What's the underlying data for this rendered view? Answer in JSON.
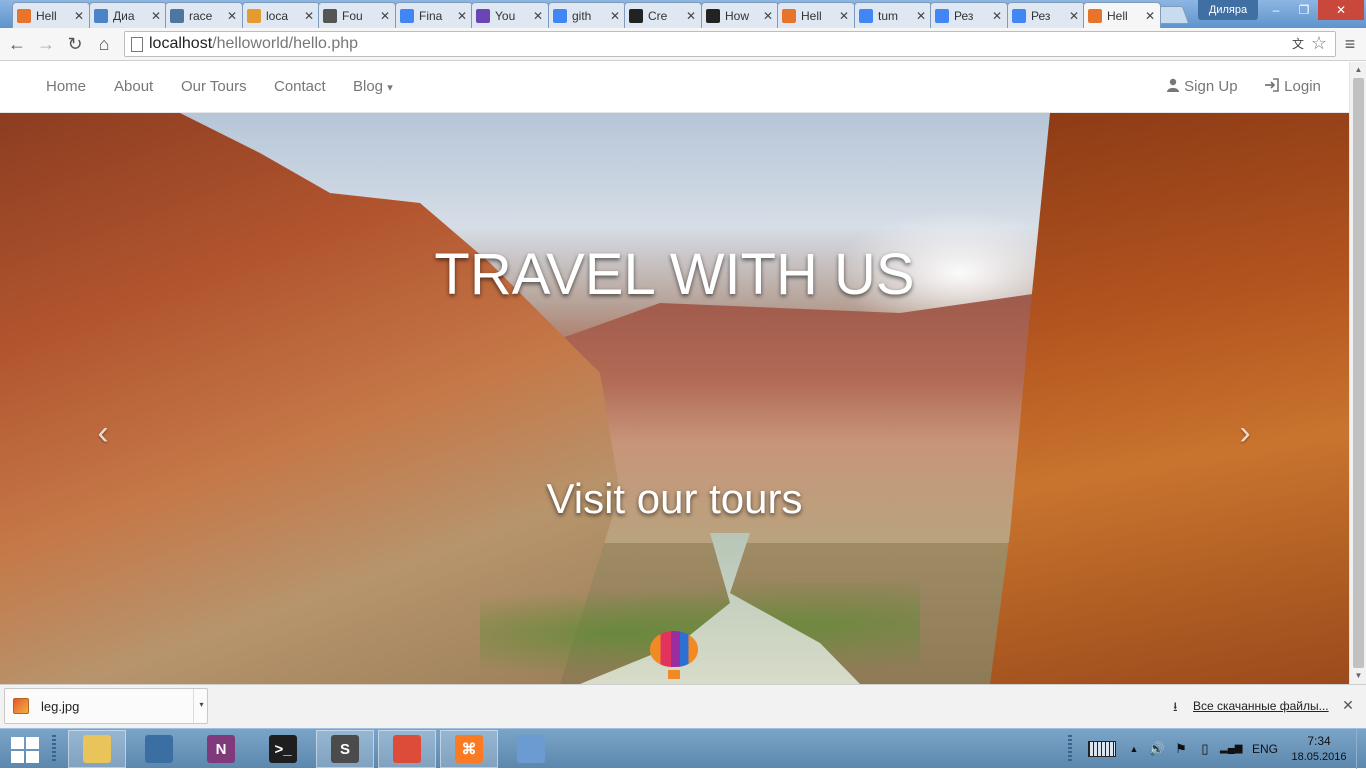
{
  "browser": {
    "tabs": [
      {
        "label": "Hell",
        "icon": "xampp-icon",
        "color": "#e8742b",
        "active": false
      },
      {
        "label": "Диа",
        "icon": "chat-icon",
        "color": "#4a83c6",
        "active": false
      },
      {
        "label": "race",
        "icon": "vk-icon",
        "color": "#4d76a1",
        "active": false
      },
      {
        "label": "loca",
        "icon": "phpmyadmin-icon",
        "color": "#e49b2f",
        "active": false
      },
      {
        "label": "Fou",
        "icon": "profile-icon",
        "color": "#555555",
        "active": false
      },
      {
        "label": "Fina",
        "icon": "google-docs-icon",
        "color": "#4285f4",
        "active": false
      },
      {
        "label": "You",
        "icon": "list-icon",
        "color": "#6a45b3",
        "active": false
      },
      {
        "label": "gith",
        "icon": "google-icon",
        "color": "#4285f4",
        "active": false
      },
      {
        "label": "Cre",
        "icon": "github-icon",
        "color": "#222222",
        "active": false
      },
      {
        "label": "How",
        "icon": "github-icon",
        "color": "#222222",
        "active": false
      },
      {
        "label": "Hell",
        "icon": "xampp-icon",
        "color": "#e8742b",
        "active": false
      },
      {
        "label": "tum",
        "icon": "google-icon",
        "color": "#4285f4",
        "active": false
      },
      {
        "label": "Рез",
        "icon": "google-icon",
        "color": "#4285f4",
        "active": false
      },
      {
        "label": "Рез",
        "icon": "google-icon",
        "color": "#4285f4",
        "active": false
      },
      {
        "label": "Hell",
        "icon": "xampp-icon",
        "color": "#e8742b",
        "active": true
      }
    ],
    "close_glyph": "✕",
    "user_badge": "Диляра",
    "window_controls": {
      "minimize": "–",
      "maximize": "❐",
      "close": "✕"
    },
    "nav": {
      "back": "←",
      "forward": "→",
      "reload": "↻",
      "home": "⌂"
    },
    "url": {
      "host": "localhost",
      "path": "/helloworld/hello.php"
    },
    "translate_icon": "文",
    "bookmark_star": "☆",
    "menu_icon": "≡"
  },
  "site": {
    "nav_left": [
      "Home",
      "About",
      "Our Tours",
      "Contact"
    ],
    "blog_label": "Blog",
    "blog_caret": "▾",
    "signup_label": "Sign Up",
    "login_label": "Login",
    "signup_icon": "user-icon",
    "login_icon": "login-icon",
    "hero": {
      "title": "TRAVEL WITH US",
      "subtitle": "Visit our tours",
      "prev_arrow": "‹",
      "next_arrow": "›"
    }
  },
  "downloads": {
    "file_name": "leg.jpg",
    "caret": "▾",
    "all_downloads": "Все скачанные файлы...",
    "download_icon": "⭳",
    "close": "✕"
  },
  "taskbar": {
    "apps": [
      {
        "name": "file-explorer",
        "glyph": "",
        "color": "#e9c45a",
        "running": true
      },
      {
        "name": "python",
        "glyph": "",
        "color": "#3b6fa3",
        "running": false
      },
      {
        "name": "onenote",
        "glyph": "N",
        "color": "#80397b",
        "running": false
      },
      {
        "name": "terminal",
        "glyph": ">_",
        "color": "#1e1e1e",
        "running": false
      },
      {
        "name": "sublime-text",
        "glyph": "S",
        "color": "#4b4b4b",
        "running": true
      },
      {
        "name": "chrome",
        "glyph": "",
        "color": "#dd4b39",
        "running": true
      },
      {
        "name": "xampp",
        "glyph": "⌘",
        "color": "#fb7a24",
        "running": true
      },
      {
        "name": "paint",
        "glyph": "",
        "color": "#6c9bd2",
        "running": false
      }
    ],
    "language": "ENG",
    "time": "7:34",
    "date": "18.05.2016",
    "tray": {
      "up_arrow": "▲",
      "volume": "🔊",
      "flag": "⚑",
      "battery": "▯",
      "signal": "▂▄▆"
    }
  }
}
